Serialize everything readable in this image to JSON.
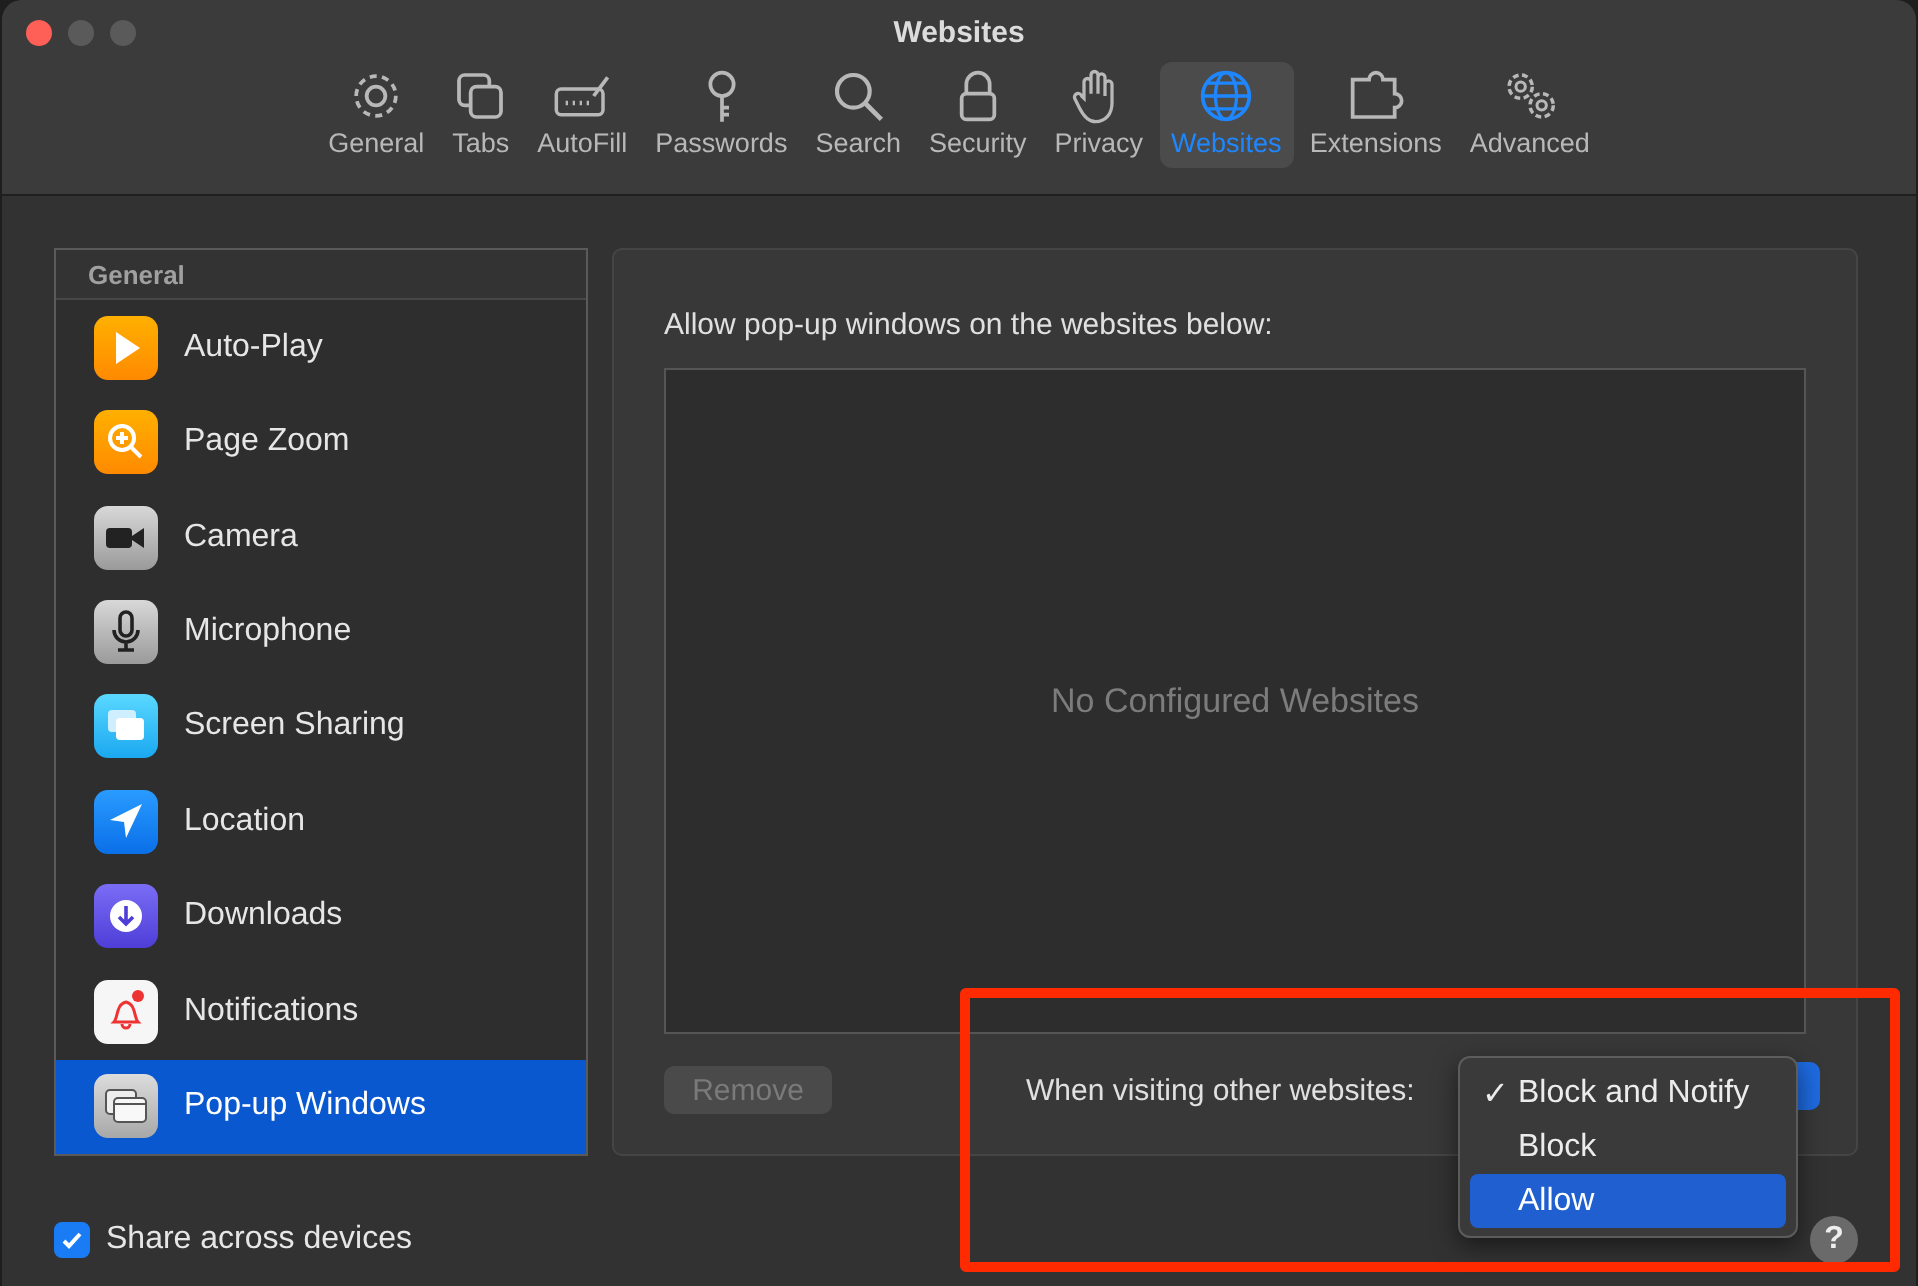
{
  "window": {
    "title": "Websites"
  },
  "toolbar": [
    {
      "label": "General",
      "selected": false
    },
    {
      "label": "Tabs",
      "selected": false
    },
    {
      "label": "AutoFill",
      "selected": false
    },
    {
      "label": "Passwords",
      "selected": false
    },
    {
      "label": "Search",
      "selected": false
    },
    {
      "label": "Security",
      "selected": false
    },
    {
      "label": "Privacy",
      "selected": false
    },
    {
      "label": "Websites",
      "selected": true
    },
    {
      "label": "Extensions",
      "selected": false
    },
    {
      "label": "Advanced",
      "selected": false
    }
  ],
  "sidebar": {
    "header": "General",
    "items": [
      {
        "label": "Auto-Play",
        "selected": false
      },
      {
        "label": "Page Zoom",
        "selected": false
      },
      {
        "label": "Camera",
        "selected": false
      },
      {
        "label": "Microphone",
        "selected": false
      },
      {
        "label": "Screen Sharing",
        "selected": false
      },
      {
        "label": "Location",
        "selected": false
      },
      {
        "label": "Downloads",
        "selected": false
      },
      {
        "label": "Notifications",
        "selected": false
      },
      {
        "label": "Pop-up Windows",
        "selected": true
      }
    ]
  },
  "share_checkbox": {
    "label": "Share across devices",
    "checked": true
  },
  "panel": {
    "heading": "Allow pop-up windows on the websites below:",
    "empty_text": "No Configured Websites",
    "remove_button": {
      "label": "Remove",
      "disabled": true
    },
    "other_label": "When visiting other websites:",
    "menu": [
      {
        "label": "Block and Notify",
        "checked": true,
        "selected": false
      },
      {
        "label": "Block",
        "checked": false,
        "selected": false
      },
      {
        "label": "Allow",
        "checked": false,
        "selected": true
      }
    ],
    "check_mark": "✓"
  },
  "help_button": {
    "label": "?"
  }
}
